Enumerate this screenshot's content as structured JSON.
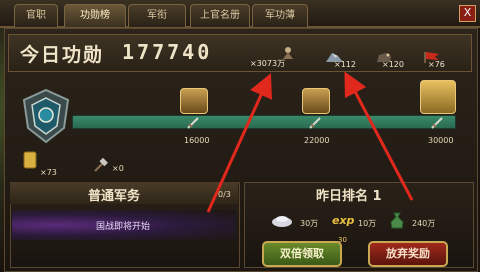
{
  "tabs": [
    {
      "label": "官职"
    },
    {
      "label": "功勋榜"
    },
    {
      "label": "军衔"
    },
    {
      "label": "上官名册"
    },
    {
      "label": "军功薄"
    }
  ],
  "close_label": "X",
  "header": {
    "title": "今日功勋",
    "score": "177740",
    "resources": [
      {
        "icon": "soldier-icon",
        "value": "×3073万"
      },
      {
        "icon": "ore-icon",
        "value": "×112"
      },
      {
        "icon": "horse-icon",
        "value": "×120"
      },
      {
        "icon": "flag-icon",
        "value": "×76"
      }
    ]
  },
  "progress": {
    "milestones": [
      {
        "value": "16000"
      },
      {
        "value": "22000"
      },
      {
        "value": "30000"
      }
    ]
  },
  "items": [
    {
      "icon": "token-icon",
      "value": "×73"
    },
    {
      "icon": "hammer-icon",
      "value": "×0"
    }
  ],
  "military": {
    "title": "普通军务",
    "count": "0/3",
    "notice": "国战即将开始"
  },
  "rank": {
    "title": "昨日排名 1",
    "rewards": [
      {
        "icon": "silver-icon",
        "value": "30万"
      },
      {
        "icon": "exp-icon",
        "label": "exp",
        "value": "10万"
      },
      {
        "icon": "money-bag-icon",
        "value": "240万"
      }
    ],
    "cost": "30",
    "double_label": "双倍领取",
    "abandon_label": "放弃奖励"
  },
  "colors": {
    "accent_red": "#e0281c",
    "gold": "#c8a850",
    "track": "#3a8a6a"
  }
}
